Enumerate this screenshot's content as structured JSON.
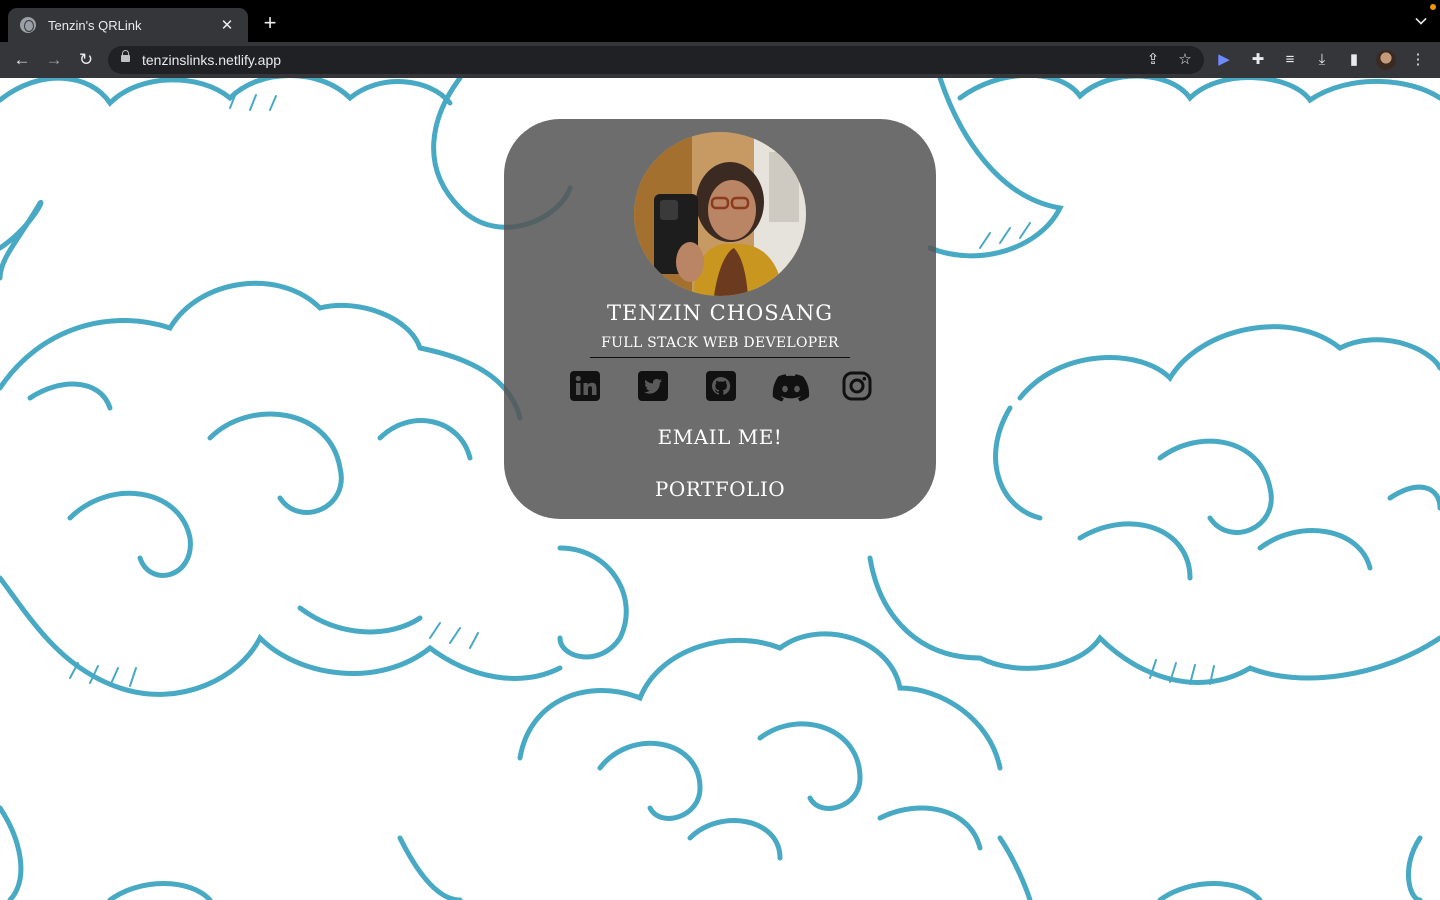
{
  "browser": {
    "tab_title": "Tenzin's QRLink",
    "url": "tenzinslinks.netlify.app"
  },
  "profile": {
    "name": "TENZIN CHOSANG",
    "role": "FULL STACK WEB DEVELOPER"
  },
  "socials": [
    {
      "name": "linkedin",
      "icon": "linkedin-icon"
    },
    {
      "name": "twitter",
      "icon": "twitter-icon"
    },
    {
      "name": "github",
      "icon": "github-icon"
    },
    {
      "name": "discord",
      "icon": "discord-icon"
    },
    {
      "name": "instagram",
      "icon": "instagram-icon"
    }
  ],
  "links": {
    "email": "EMAIL ME!",
    "portfolio": "PORTFOLIO"
  },
  "colors": {
    "cloud_stroke": "#47a9c4",
    "card": "#555555",
    "chrome_dark": "#35363a"
  }
}
